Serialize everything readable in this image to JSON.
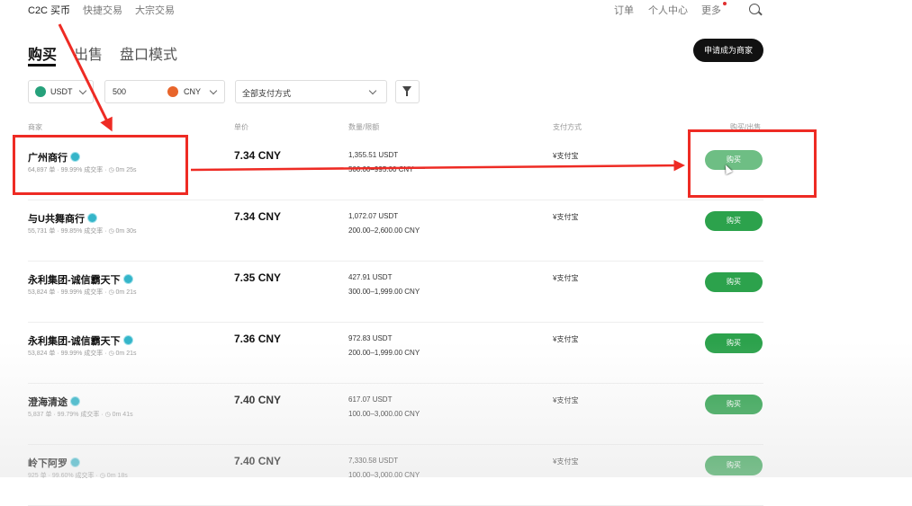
{
  "nav": {
    "items": [
      "C2C 买币",
      "快捷交易",
      "大宗交易"
    ],
    "right": [
      "订单",
      "个人中心",
      "更多"
    ]
  },
  "tabs": [
    "购买",
    "出售",
    "盘口模式"
  ],
  "merchant_button": "申请成为商家",
  "filters": {
    "coin": "USDT",
    "amount": "500",
    "currency": "CNY",
    "payment": "全部支付方式"
  },
  "headers": [
    "商家",
    "单价",
    "数量/限额",
    "支付方式",
    "购买/出售"
  ],
  "rows": [
    {
      "name": "广州商行",
      "stats": "64,897 单 · 99.99% 成交率 · ◷ 0m 25s",
      "price": "7.34 CNY",
      "amount": "1,355.51 USDT",
      "limit": "500.00–995.00 CNY",
      "pay": "¥支付宝",
      "buy": "购买"
    },
    {
      "name": "与U共舞商行",
      "stats": "55,731 单 · 99.85% 成交率 · ◷ 0m 30s",
      "price": "7.34 CNY",
      "amount": "1,072.07 USDT",
      "limit": "200.00–2,600.00 CNY",
      "pay": "¥支付宝",
      "buy": "购买"
    },
    {
      "name": "永利集团-诚信霸天下",
      "stats": "53,824 单 · 99.99% 成交率 · ◷ 0m 21s",
      "price": "7.35 CNY",
      "amount": "427.91 USDT",
      "limit": "300.00–1,999.00 CNY",
      "pay": "¥支付宝",
      "buy": "购买"
    },
    {
      "name": "永利集团-诚信霸天下",
      "stats": "53,824 单 · 99.99% 成交率 · ◷ 0m 21s",
      "price": "7.36 CNY",
      "amount": "972.83 USDT",
      "limit": "200.00–1,999.00 CNY",
      "pay": "¥支付宝",
      "buy": "购买"
    },
    {
      "name": "澄海清途",
      "stats": "5,837 单 · 99.79% 成交率 · ◷ 0m 41s",
      "price": "7.40 CNY",
      "amount": "617.07 USDT",
      "limit": "100.00–3,000.00 CNY",
      "pay": "¥支付宝",
      "buy": "购买"
    },
    {
      "name": "岭下阿罗",
      "stats": "925 单 · 99.60% 成交率 · ◷ 0m 18s",
      "price": "7.40 CNY",
      "amount": "7,330.58 USDT",
      "limit": "100.00–3,000.00 CNY",
      "pay": "¥支付宝",
      "buy": "购买"
    }
  ],
  "colors": {
    "accent": "#2ca24c",
    "annotation": "#ee2b24",
    "verify": "#35b5c9"
  }
}
